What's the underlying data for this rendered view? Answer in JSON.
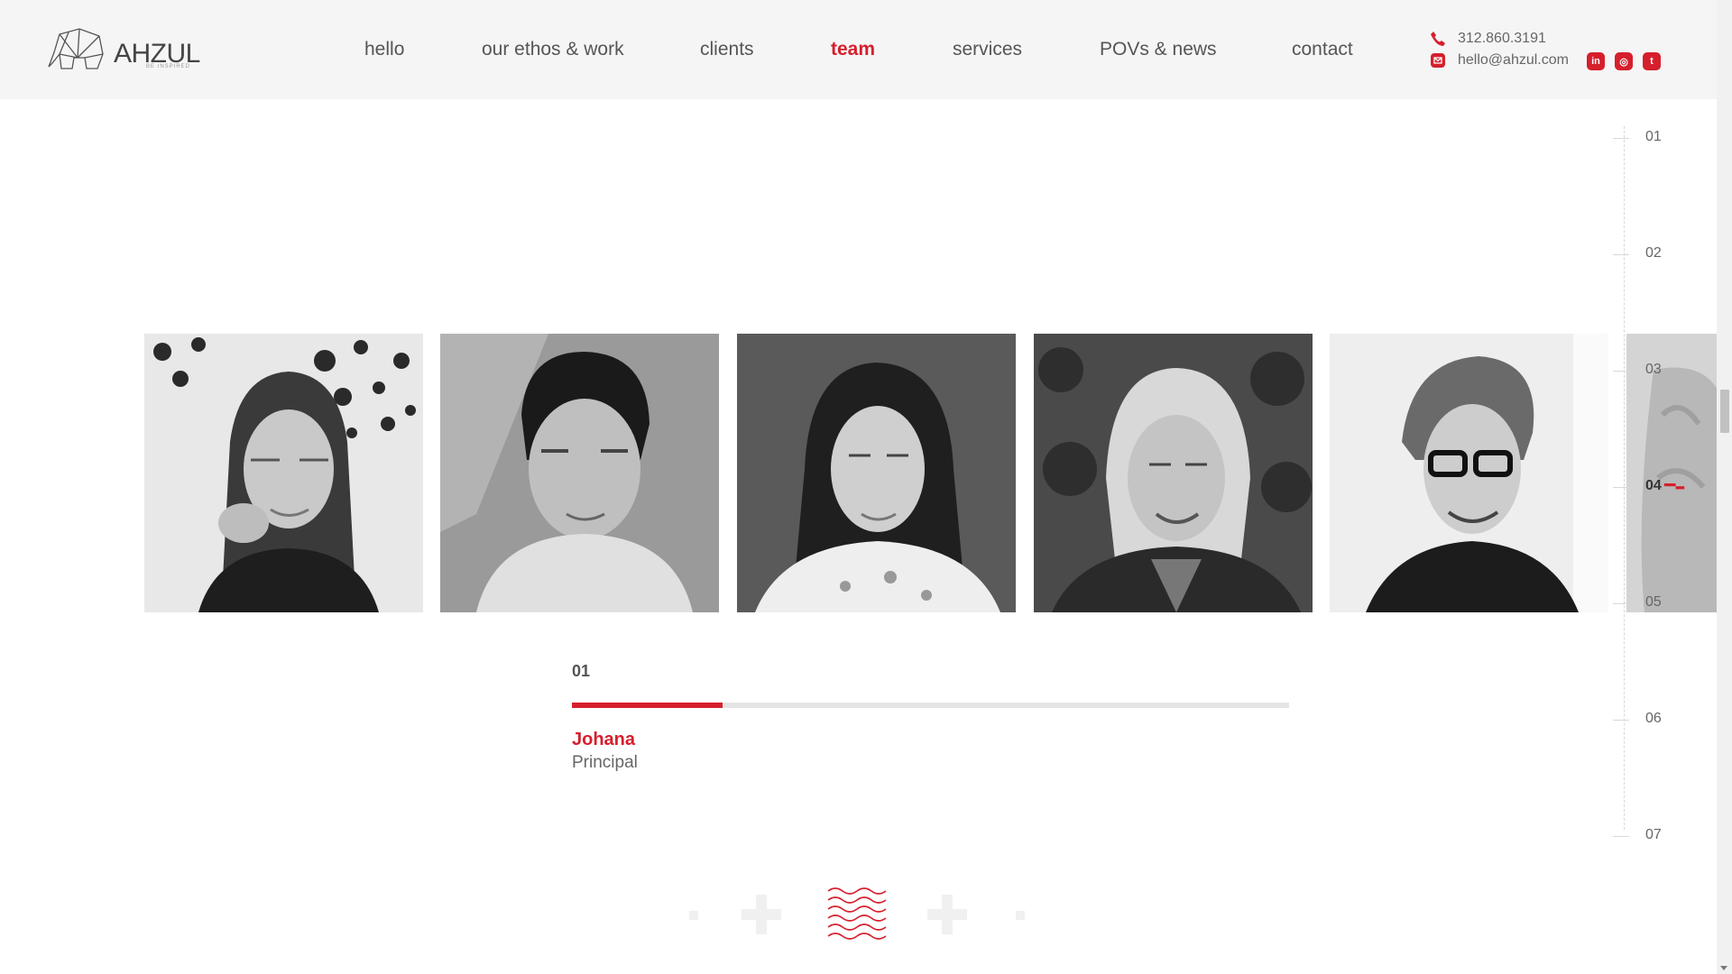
{
  "brand": {
    "name": "AHZUL",
    "tagline": "BE INSPIRED"
  },
  "nav": [
    {
      "label": "hello",
      "active": false
    },
    {
      "label": "our ethos & work",
      "active": false
    },
    {
      "label": "clients",
      "active": false
    },
    {
      "label": "team",
      "active": true
    },
    {
      "label": "services",
      "active": false
    },
    {
      "label": "POVs & news",
      "active": false
    },
    {
      "label": "contact",
      "active": false
    }
  ],
  "contact": {
    "phone": "312.860.3191",
    "email": "hello@ahzul.com"
  },
  "socials": [
    {
      "icon": "linkedin-icon",
      "glyph": "in"
    },
    {
      "icon": "instagram-icon",
      "glyph": "◎"
    },
    {
      "icon": "twitter-icon",
      "glyph": "t"
    }
  ],
  "team": {
    "photos": [
      {
        "name": "team-photo-1"
      },
      {
        "name": "team-photo-2"
      },
      {
        "name": "team-photo-3"
      },
      {
        "name": "team-photo-4"
      },
      {
        "name": "team-photo-5"
      },
      {
        "name": "team-photo-6"
      }
    ],
    "current": {
      "index": "01",
      "name": "Johana",
      "role": "Principal",
      "progress": 0.21
    }
  },
  "timeline": {
    "labels": [
      "01",
      "02",
      "03",
      "04",
      "05",
      "06",
      "07"
    ],
    "current": "04"
  },
  "colors": {
    "accent": "#d61f2c",
    "header_bg": "#f5f5f5"
  }
}
